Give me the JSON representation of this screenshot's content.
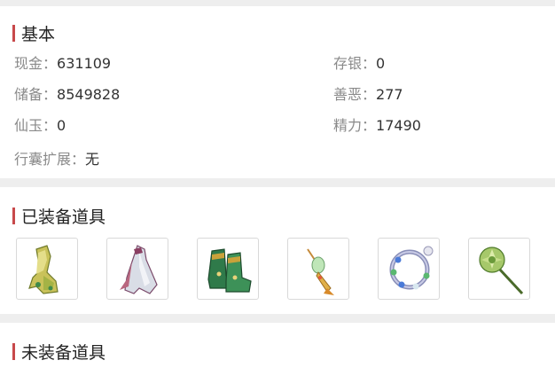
{
  "basic": {
    "title": "基本",
    "fields": [
      {
        "label": "现金",
        "value": "631109"
      },
      {
        "label": "存银",
        "value": "0"
      },
      {
        "label": "储备",
        "value": "8549828"
      },
      {
        "label": "善恶",
        "value": "277"
      },
      {
        "label": "仙玉",
        "value": "0"
      },
      {
        "label": "精力",
        "value": "17490"
      },
      {
        "label": "行囊扩展",
        "value": "无"
      }
    ],
    "separator": "："
  },
  "equipped": {
    "title": "已装备道具",
    "items": [
      {
        "icon": "jade-armor-icon"
      },
      {
        "icon": "silk-robe-icon"
      },
      {
        "icon": "green-boots-icon"
      },
      {
        "icon": "jade-pendant-icon"
      },
      {
        "icon": "bead-bracelet-icon"
      },
      {
        "icon": "green-flower-staff-icon"
      }
    ]
  },
  "unequipped": {
    "title": "未装备道具"
  },
  "colors": {
    "accent_bar": "#c8494b",
    "label_gray": "#8a8a8a",
    "page_bg": "#eeeeee"
  }
}
